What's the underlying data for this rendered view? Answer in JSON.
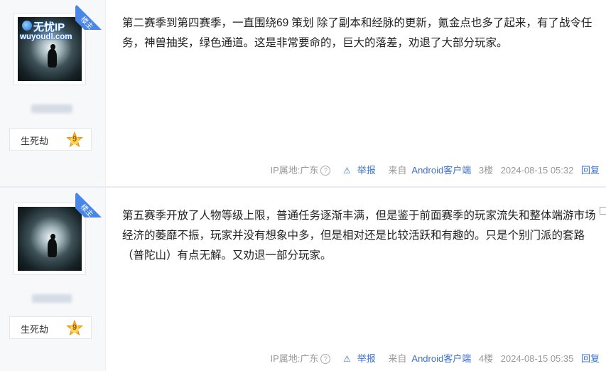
{
  "posts": [
    {
      "corner_label": "楼主",
      "watermark_title": "无忧IP",
      "watermark_url": "wuyoudl.com",
      "level_name": "生死劫",
      "level_num": "9",
      "content": "第二赛季到第四赛季，一直围绕69 策划 除了副本和经脉的更新，氪金点也多了起来，有了战令任务，神兽抽奖，绿色通道。这是非常要命的，巨大的落差，劝退了大部分玩家。",
      "ip": "IP属地:广东",
      "report": "举报",
      "from": "来自",
      "client": "Android客户端",
      "floor": "3楼",
      "time": "2024-08-15 05:32",
      "reply": "回复"
    },
    {
      "corner_label": "楼主",
      "level_name": "生死劫",
      "level_num": "9",
      "content": "第五赛季开放了人物等级上限，普通任务逐渐丰满，但是鉴于前面赛季的玩家流失和整体端游市场经济的萎靡不振，玩家并没有想象中多，但是相对还是比较活跃和有趣的。只是个别门派的套路（普陀山）有点无解。又劝退一部分玩家。",
      "ip": "IP属地:广东",
      "report": "举报",
      "from": "来自",
      "client": "Android客户端",
      "floor": "4楼",
      "time": "2024-08-15 05:35",
      "reply": "回复"
    }
  ],
  "accent_color": "#4a86e8",
  "link_color": "#3b6fd1"
}
